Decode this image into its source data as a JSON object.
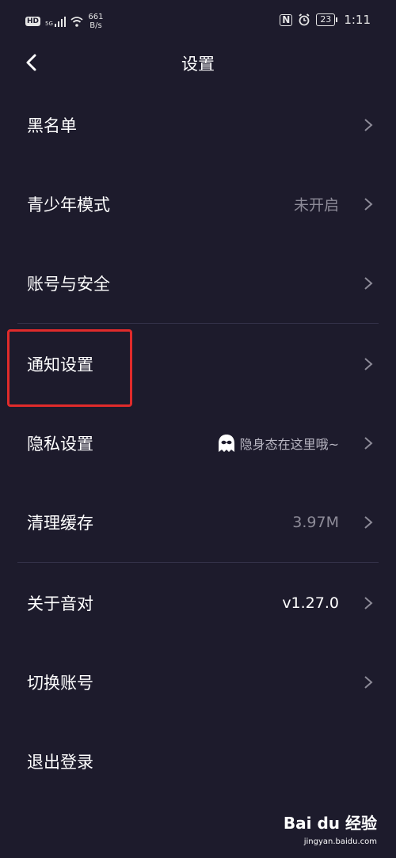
{
  "status_bar": {
    "hd_badge": "HD",
    "network_label": "5G",
    "speed_value": "661",
    "speed_unit": "B/s",
    "nfc_label": "N",
    "battery_level": "23",
    "time": "1:11"
  },
  "header": {
    "title": "设置"
  },
  "settings": [
    {
      "label": "黑名单",
      "value": ""
    },
    {
      "label": "青少年模式",
      "value": "未开启"
    },
    {
      "label": "账号与安全",
      "value": ""
    },
    {
      "label": "通知设置",
      "value": ""
    },
    {
      "label": "隐私设置",
      "value": "隐身态在这里哦~"
    },
    {
      "label": "清理缓存",
      "value": "3.97M"
    },
    {
      "label": "关于音对",
      "value": "v1.27.0"
    },
    {
      "label": "切换账号",
      "value": ""
    },
    {
      "label": "退出登录",
      "value": ""
    }
  ],
  "watermark": {
    "brand": "Bai du 经验",
    "url": "jingyan.baidu.com"
  },
  "colors": {
    "background": "#1d1b2c",
    "text": "#ffffff",
    "secondary_text": "#8d8b98",
    "divider": "#34324a",
    "highlight": "#e02b2b"
  }
}
